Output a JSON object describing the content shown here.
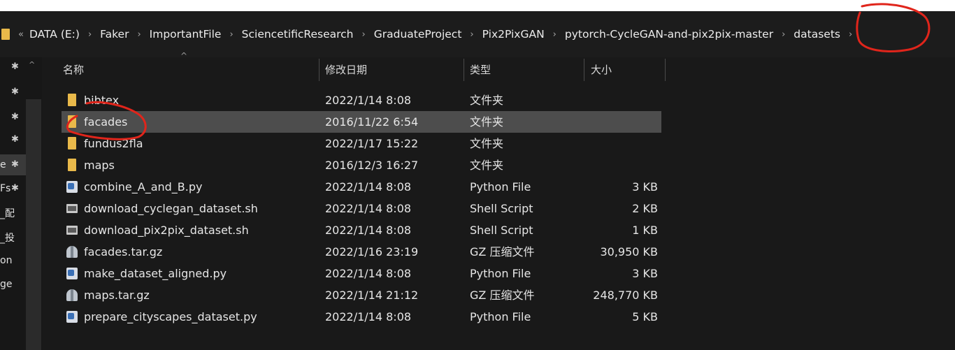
{
  "address_bar": {
    "ellipsis": "«",
    "separator": "›",
    "crumbs": [
      "DATA (E:)",
      "Faker",
      "ImportantFile",
      "SciencetificResearch",
      "GraduateProject",
      "Pix2PixGAN",
      "pytorch-CycleGAN-and-pix2pix-master",
      "datasets"
    ]
  },
  "nav_pane": {
    "pin_glyph": "✱",
    "scroll_up": "^",
    "fragments": [
      "e",
      "Fs",
      "_配",
      "_投",
      "on",
      "ge"
    ]
  },
  "columns": {
    "name": "名称",
    "date": "修改日期",
    "type": "类型",
    "size": "大小",
    "sort_caret": "^"
  },
  "files": [
    {
      "name": "bibtex",
      "date": "2022/1/14 8:08",
      "type": "文件夹",
      "size": "",
      "icon": "folder-icon"
    },
    {
      "name": "facades",
      "date": "2016/11/22 6:54",
      "type": "文件夹",
      "size": "",
      "icon": "folder-icon",
      "selected": true
    },
    {
      "name": "fundus2fla",
      "date": "2022/1/17 15:22",
      "type": "文件夹",
      "size": "",
      "icon": "folder-icon"
    },
    {
      "name": "maps",
      "date": "2016/12/3 16:27",
      "type": "文件夹",
      "size": "",
      "icon": "folder-icon"
    },
    {
      "name": "combine_A_and_B.py",
      "date": "2022/1/14 8:08",
      "type": "Python File",
      "size": "3 KB",
      "icon": "python-file-icon"
    },
    {
      "name": "download_cyclegan_dataset.sh",
      "date": "2022/1/14 8:08",
      "type": "Shell Script",
      "size": "2 KB",
      "icon": "shell-script-icon"
    },
    {
      "name": "download_pix2pix_dataset.sh",
      "date": "2022/1/14 8:08",
      "type": "Shell Script",
      "size": "1 KB",
      "icon": "shell-script-icon"
    },
    {
      "name": "facades.tar.gz",
      "date": "2022/1/16 23:19",
      "type": "GZ 压缩文件",
      "size": "30,950 KB",
      "icon": "archive-icon"
    },
    {
      "name": "make_dataset_aligned.py",
      "date": "2022/1/14 8:08",
      "type": "Python File",
      "size": "3 KB",
      "icon": "python-file-icon"
    },
    {
      "name": "maps.tar.gz",
      "date": "2022/1/14 21:12",
      "type": "GZ 压缩文件",
      "size": "248,770 KB",
      "icon": "archive-icon"
    },
    {
      "name": "prepare_cityscapes_dataset.py",
      "date": "2022/1/14 8:08",
      "type": "Python File",
      "size": "5 KB",
      "icon": "python-file-icon"
    }
  ],
  "colors": {
    "annotation": "#e0251b",
    "folder": "#e9b94a",
    "selection": "#4d4d4d"
  }
}
